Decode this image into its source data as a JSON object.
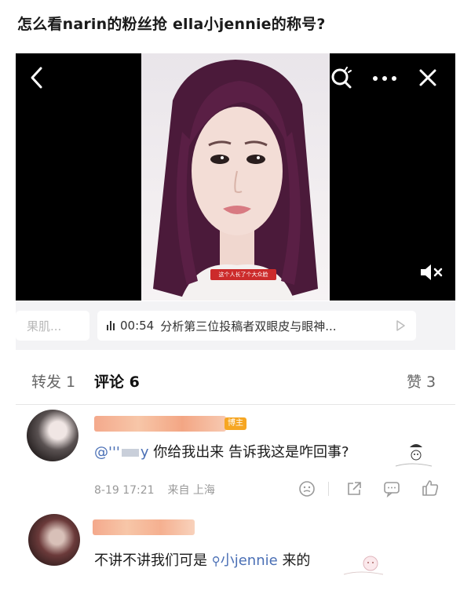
{
  "post": {
    "title": "怎么看narin的粉丝抢 ella小jennie的称号?"
  },
  "video": {
    "subtitle": "这个人长了个大众脸"
  },
  "related": {
    "left_chip": "果肌...",
    "current_duration": "00:54",
    "current_title": "分析第三位投稿者双眼皮与眼神..."
  },
  "tabs": {
    "repost": "转发 1",
    "comments": "评论 6",
    "likes": "赞 3"
  },
  "comments": [
    {
      "badge": "博主",
      "mention_prefix": "@'''",
      "mention_suffix": "y",
      "text": "你给我出来 告诉我这是咋回事?",
      "time": "8-19 17:21",
      "location": "来自 上海"
    },
    {
      "text_before": "不讲不讲我们可是",
      "mention": "小jennie",
      "text_after": "来的"
    }
  ],
  "icons": {
    "back": "chevron-left-icon",
    "search": "search-icon",
    "more": "more-dots-icon",
    "close": "close-icon",
    "mute": "speaker-mute-icon",
    "play": "play-icon"
  },
  "colors": {
    "mention": "#4a6fb5",
    "badge": "#f6a623",
    "subtitle_bg": "#cc2b2b"
  }
}
